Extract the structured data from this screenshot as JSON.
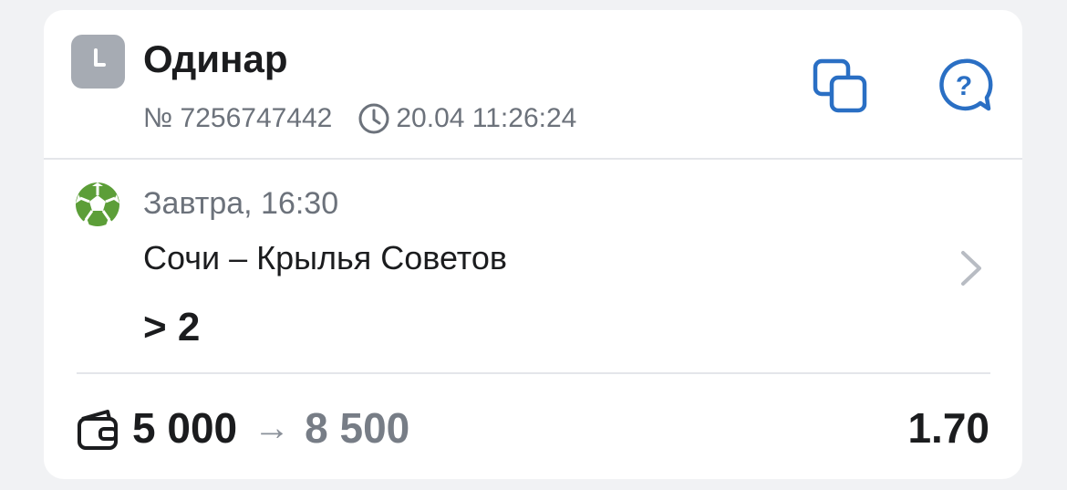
{
  "header": {
    "status_icon": "clock-icon",
    "bet_type": "Одинар",
    "bet_number": "№ 7256747442",
    "datetime": "20.04 11:26:24"
  },
  "actions": {
    "copy_icon": "copy-icon",
    "help_icon": "help-icon",
    "help_glyph": "?"
  },
  "event": {
    "sport_icon": "soccer-ball-icon",
    "time": "Завтра, 16:30",
    "name": "Сочи – Крылья Советов",
    "outcome": "> 2"
  },
  "footer": {
    "wallet_icon": "wallet-icon",
    "stake": "5 000",
    "arrow": "→",
    "payout": "8 500",
    "odds": "1.70"
  },
  "colors": {
    "accent": "#2a6fc4",
    "sport": "#5c9e38",
    "status_tile": "#a6abb3",
    "muted_text": "#6c727b"
  }
}
